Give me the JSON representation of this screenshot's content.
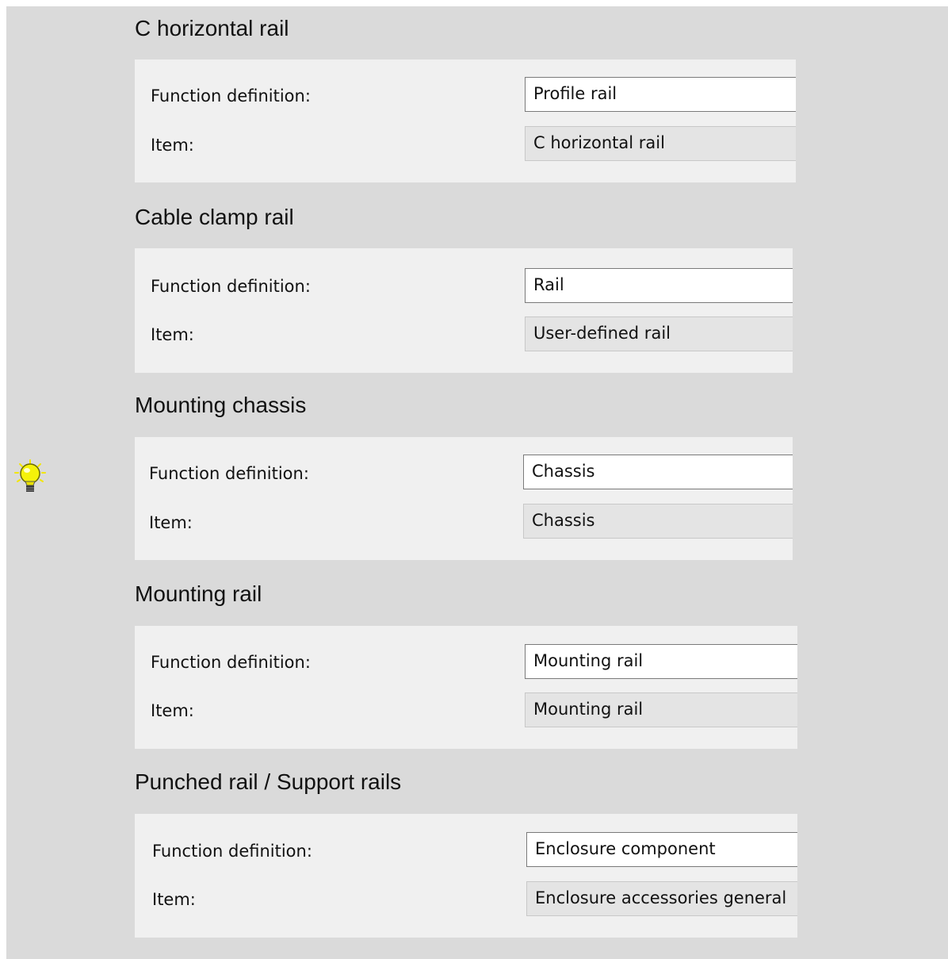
{
  "sections": [
    {
      "title": "C horizontal rail",
      "function_label": "Function definition:",
      "function_value": "Profile rail",
      "item_label": "Item:",
      "item_value": "C horizontal rail"
    },
    {
      "title": "Cable clamp rail",
      "function_label": "Function definition:",
      "function_value": "Rail",
      "item_label": "Item:",
      "item_value": "User-defined rail"
    },
    {
      "title": "Mounting chassis",
      "function_label": "Function definition:",
      "function_value": "Chassis",
      "item_label": "Item:",
      "item_value": "Chassis"
    },
    {
      "title": "Mounting rail",
      "function_label": "Function definition:",
      "function_value": "Mounting rail",
      "item_label": "Item:",
      "item_value": "Mounting rail"
    },
    {
      "title": "Punched rail / Support rails",
      "function_label": "Function definition:",
      "function_value": "Enclosure component",
      "item_label": "Item:",
      "item_value": "Enclosure accessories general"
    }
  ],
  "icons": {
    "tip": "lightbulb-icon"
  },
  "colors": {
    "frame": "#dadada",
    "panel": "#f0f0f0",
    "bulb": "#f5f20a"
  }
}
